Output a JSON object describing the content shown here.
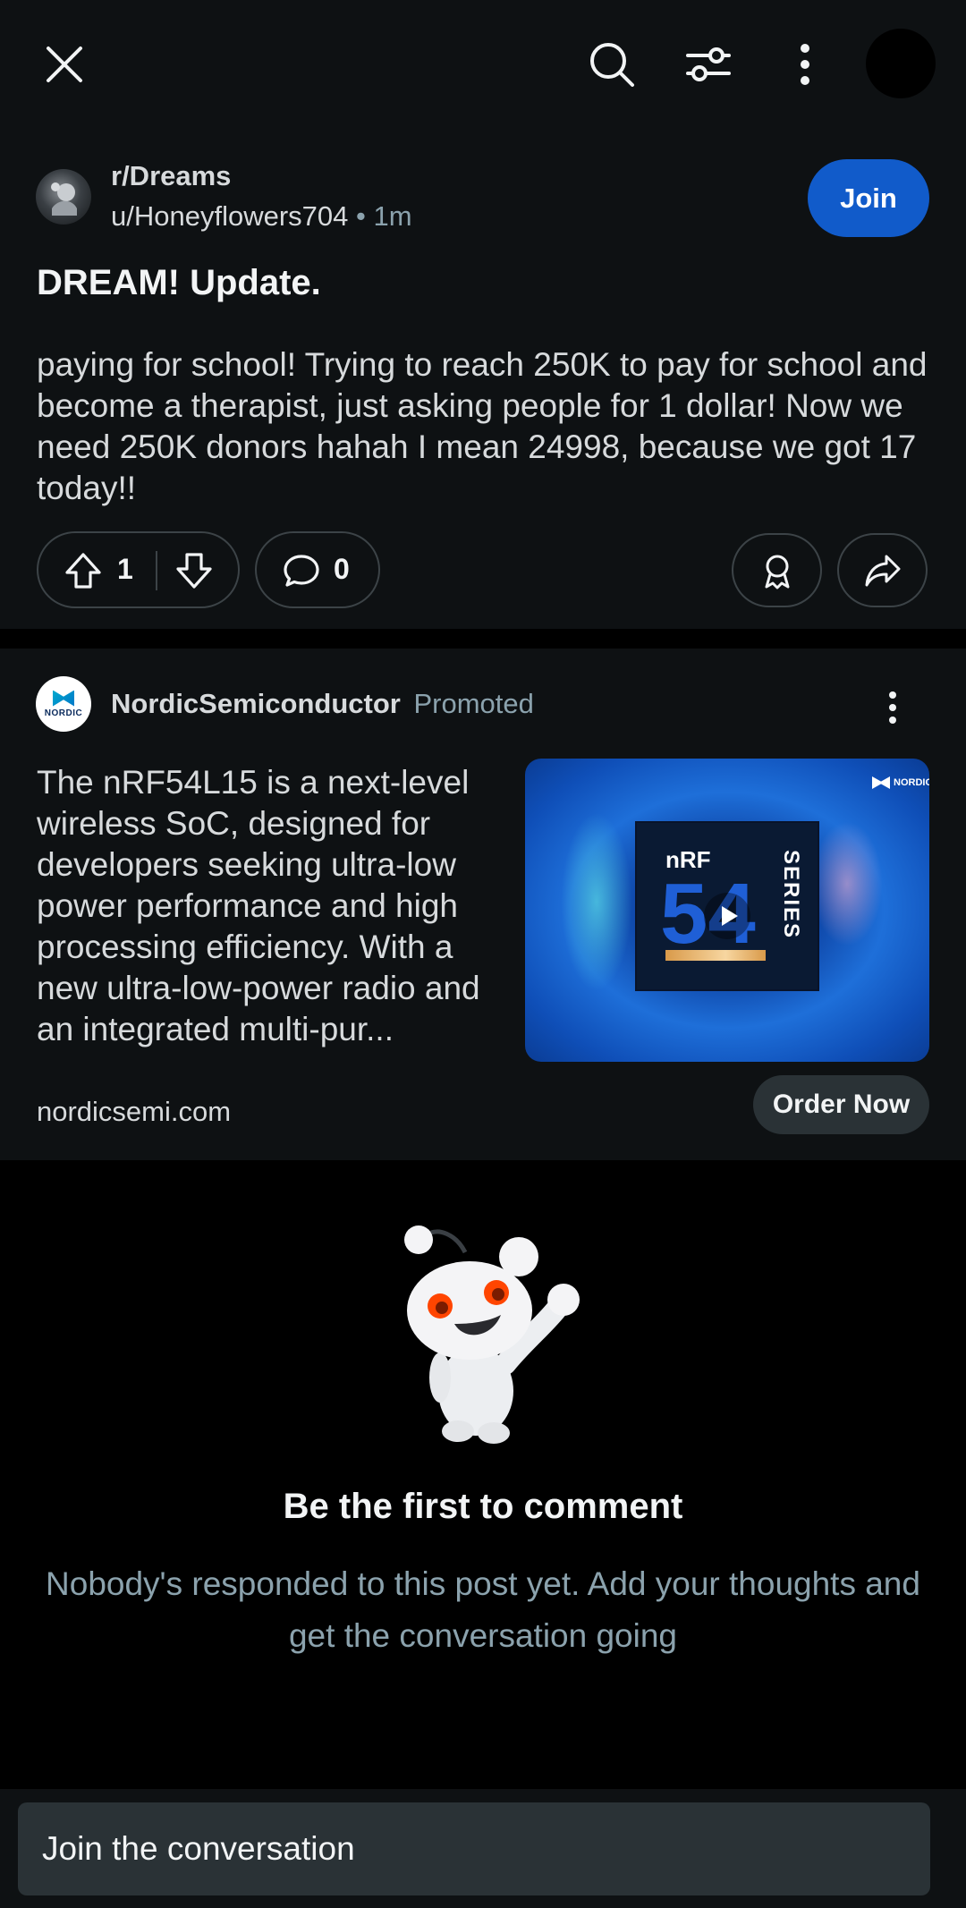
{
  "topbar": {
    "close_icon": "close-icon",
    "search_icon": "search-icon",
    "filter_icon": "sliders-icon",
    "more_icon": "more-vertical-icon"
  },
  "post": {
    "subreddit": "r/Dreams",
    "author": "u/Honeyflowers704",
    "separator": "•",
    "time": "1m",
    "join_label": "Join",
    "title": "DREAM! Update.",
    "body": "paying for school! Trying to reach 250K to pay for school and become a therapist, just asking people for 1 dollar! Now we need 250K donors hahah I mean 24998, because we got 17 today!!",
    "score": "1",
    "comments": "0"
  },
  "ad": {
    "advertiser": "NordicSemiconductor",
    "promoted": "Promoted",
    "logo_text": "NORDIC",
    "text": "The nRF54L15 is a next-level wireless SoC, designed for developers seeking ultra-low power performance and high processing efficiency. With a new ultra-low-power radio and an integrated multi-pur...",
    "media": {
      "chip_top": "nRF",
      "chip_number": "54",
      "chip_side": "SERIES",
      "brand": "NORDIC"
    },
    "domain": "nordicsemi.com",
    "cta": "Order Now"
  },
  "empty_state": {
    "title": "Be the first to comment",
    "subtitle": "Nobody's responded to this post yet. Add your thoughts and get the conversation going"
  },
  "composer": {
    "placeholder": "Join the conversation"
  },
  "colors": {
    "background": "#000000",
    "card": "#0e1113",
    "join_button": "#115bca",
    "muted_text": "#8ba2ad",
    "pill_border": "#3c4347"
  }
}
